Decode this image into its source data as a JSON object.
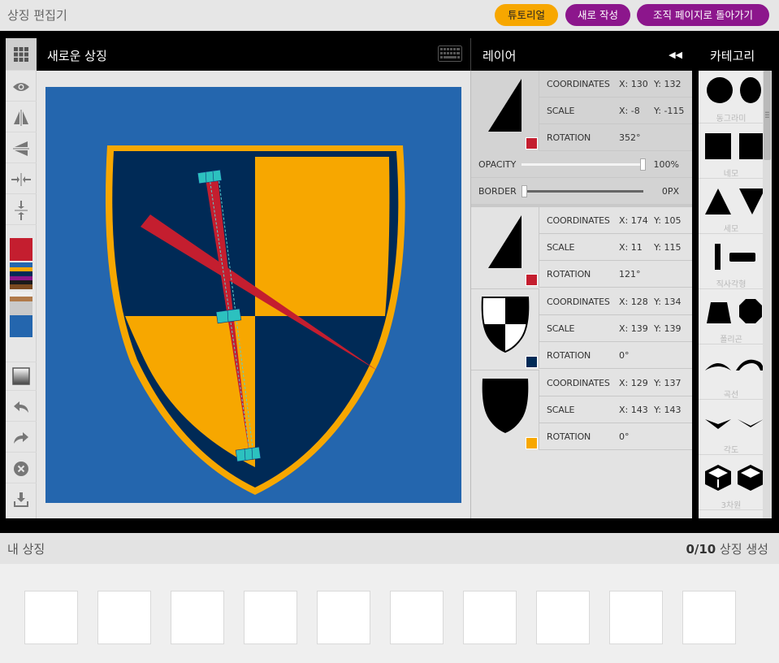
{
  "app": {
    "title": "상징 편집기",
    "tutorial_label": "튜토리얼",
    "new_label": "새로 작성",
    "back_label": "조직 페이지로 돌아가기"
  },
  "canvas": {
    "title": "새로운 상징",
    "background": "#2466ae"
  },
  "palette": [
    "#c41e2f",
    "#2466ae",
    "#f7a700",
    "#002a56",
    "#8c168c",
    "#1b1b1b",
    "#7b4a20",
    "#eeeeee",
    "#b07a4a",
    "#c9c9c9",
    "#2466ae"
  ],
  "layers_panel": {
    "title": "레이어",
    "opacity_label": "OPACITY",
    "opacity_value": "100%",
    "opacity_level": 1.0,
    "border_label": "BORDER",
    "border_value": "0PX",
    "border_level": 0.0,
    "layers": [
      {
        "coordinates_label": "COORDINATES",
        "x": "X: 130",
        "y": "Y: 132",
        "scale_label": "SCALE",
        "sx": "X: -8",
        "sy": "Y: -115",
        "rotation_label": "ROTATION",
        "rotation": "352°",
        "color": "#c41e2f"
      },
      {
        "coordinates_label": "COORDINATES",
        "x": "X: 174",
        "y": "Y: 105",
        "scale_label": "SCALE",
        "sx": "X: 11",
        "sy": "Y: 115",
        "rotation_label": "ROTATION",
        "rotation": "121°",
        "color": "#c41e2f"
      },
      {
        "coordinates_label": "COORDINATES",
        "x": "X: 128",
        "y": "Y: 134",
        "scale_label": "SCALE",
        "sx": "X: 139",
        "sy": "Y: 139",
        "rotation_label": "ROTATION",
        "rotation": "0°",
        "color": "#002a56"
      },
      {
        "coordinates_label": "COORDINATES",
        "x": "X: 129",
        "y": "Y: 137",
        "scale_label": "SCALE",
        "sx": "X: 143",
        "sy": "Y: 143",
        "rotation_label": "ROTATION",
        "rotation": "0°",
        "color": "#f7a700"
      }
    ]
  },
  "categories_panel": {
    "title": "카테고리",
    "labels": [
      "동그라미",
      "네모",
      "세모",
      "직사각형",
      "폴리곤",
      "곡선",
      "각도",
      "3차원"
    ]
  },
  "bottom": {
    "title": "내 상징",
    "count": "0/10",
    "count_suffix": " 상징 생성",
    "slot_count": 10
  }
}
